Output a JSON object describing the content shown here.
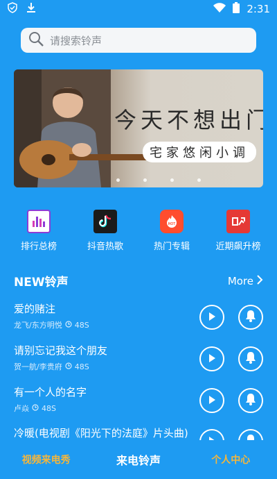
{
  "status_bar": {
    "time": "2:31",
    "icons": [
      "shield-check-icon",
      "download-icon",
      "wifi-icon",
      "battery-icon"
    ]
  },
  "search": {
    "placeholder": "请搜索铃声",
    "icon": "search-icon"
  },
  "banner": {
    "title": "今天不想出门",
    "subtitle": "宅家悠闲小调",
    "slide_count": 4,
    "active_slide": 1
  },
  "categories": [
    {
      "label": "排行总榜",
      "icon": "bar-chart-icon",
      "color": "#8e3bd6"
    },
    {
      "label": "抖音热歌",
      "icon": "tiktok-icon",
      "color": "#1b1b1b"
    },
    {
      "label": "热门专辑",
      "icon": "hot-fire-icon",
      "color": "#ff4d2e"
    },
    {
      "label": "近期飙升榜",
      "icon": "trending-up-icon",
      "color": "#e53935"
    }
  ],
  "new_section": {
    "title": "NEW铃声",
    "more_label": "More"
  },
  "songs": [
    {
      "name": "爱的赌注",
      "artist": "龙飞/东方明悦",
      "duration": "48S"
    },
    {
      "name": "请别忘记我这个朋友",
      "artist": "贺一航/李贵府",
      "duration": "48S"
    },
    {
      "name": "有一个人的名字",
      "artist": "卢焱",
      "duration": "48S"
    },
    {
      "name": "冷暖(电视剧《阳光下的法庭》片头曲)",
      "artist": "",
      "duration": ""
    }
  ],
  "tabs": [
    {
      "label": "视频来电秀",
      "state": "inactive"
    },
    {
      "label": "来电铃声",
      "state": "active"
    },
    {
      "label": "个人中心",
      "state": "inactive"
    }
  ],
  "colors": {
    "background": "#1e9bf2",
    "accent_gold": "#f5b63b",
    "search_bg": "#f4f6f8"
  }
}
